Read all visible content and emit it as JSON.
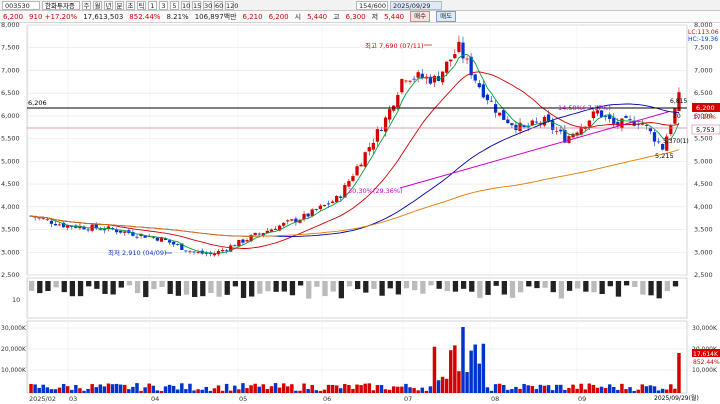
{
  "toolbar": {
    "code": "003530",
    "name": "한화투자증",
    "periods": [
      "주",
      "월",
      "년",
      "분",
      "초",
      "틱"
    ],
    "intervals": [
      "1",
      "3",
      "5",
      "10",
      "15",
      "30",
      "60",
      "120"
    ],
    "range": "154/600",
    "date": "2025/09/29"
  },
  "info": {
    "price": "6,200",
    "change": "910 +17.20%",
    "volume": "17,613,503",
    "volume_ratio": "852.44%",
    "turnover": "8.21%",
    "amount": "106,897백만",
    "prev_close": "6,210",
    "open": "6,200",
    "high_label": "시",
    "high": "5,440",
    "low_label": "고",
    "low": "6,300",
    "close_label": "저",
    "close": "5,440",
    "buy_label": "매수",
    "sell_label": "매도"
  },
  "colors": {
    "up": "#d40000",
    "down": "#0033cc",
    "ma5": "#00a03c",
    "ma20": "#d40000",
    "ma60": "#0000aa",
    "ma120": "#e87a00",
    "magenta": "#cc00cc"
  },
  "annotations": {
    "high": "최고 7,690 (07/11)",
    "low": "최저 2,910 (04/09)",
    "ref_price": "6,206",
    "pct_mid": "30.30%(29.36%)",
    "pct_right": "14.58%(-7.17%)",
    "low_right": "5,215",
    "right_vals": [
      "6,815",
      "5,370(1)",
      "20"
    ]
  },
  "legend": {
    "top_right1": "LC:113.06",
    "top_right2": "HC:-19.36"
  },
  "chart_data": [
    {
      "type": "candlestick",
      "y_ticks": [
        "8,000",
        "7,500",
        "7,000",
        "6,500",
        "6,000",
        "5,500",
        "5,000",
        "4,500",
        "4,000",
        "3,500",
        "3,000",
        "2,500"
      ],
      "ylim": [
        2500,
        8000
      ],
      "price_tags": [
        {
          "value": "6,200",
          "color": "#d40000"
        },
        {
          "value": "5,753",
          "color": "#ffffff"
        },
        {
          "value": "17.20%",
          "color": "#d40000"
        }
      ],
      "right_labels": [
        "6,200",
        "17.20%",
        "5,753"
      ]
    },
    {
      "type": "bar",
      "y_ticks": [
        "10"
      ],
      "label": "indicator"
    },
    {
      "type": "bar",
      "y_ticks": [
        "30,000K",
        "20,000K",
        "10,000K"
      ],
      "right_labels": [
        "17,614K",
        "852.44%"
      ],
      "x_ticks": [
        "2025/02",
        "03",
        "04",
        "05",
        "06",
        "07",
        "08",
        "09"
      ],
      "current_date": "2025/09/29(월)"
    }
  ]
}
